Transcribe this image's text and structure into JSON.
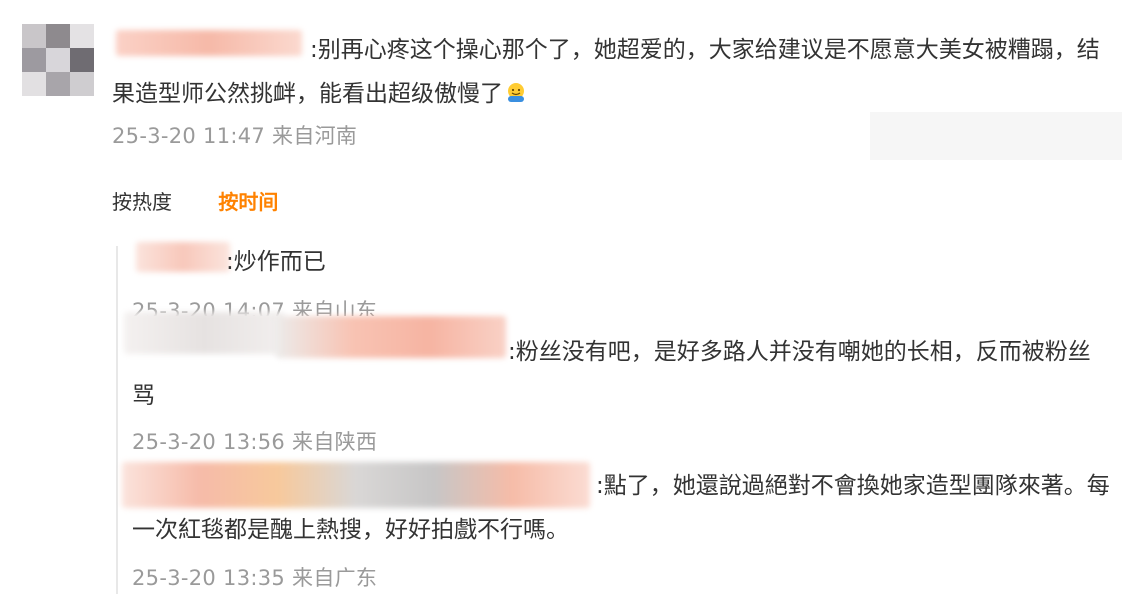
{
  "comment": {
    "text": ":别再心疼这个操心那个了，她超爱的，大家给建议是不愿意大美女被糟蹋，结果造型师公然挑衅，能看出超级傲慢了",
    "meta": "25-3-20 11:47 来自河南"
  },
  "sort": {
    "hot_label": "按热度",
    "time_label": "按时间",
    "active_color": "#ff8200"
  },
  "replies": [
    {
      "text": ":炒作而已",
      "meta": "25-3-20 14:07 来自山东"
    },
    {
      "text": ":粉丝没有吧，是好多路人并没有嘲她的长相，反而被粉丝骂",
      "meta": "25-3-20 13:56 来自陕西"
    },
    {
      "text": ":點了，她還說過絕對不會換她家造型團隊來著。每一次紅毯都是醜上熱搜，好好拍戲不行嗎。",
      "meta": "25-3-20 13:35 来自广东"
    }
  ],
  "icons": {
    "emoji": "hug-emoji-icon"
  }
}
